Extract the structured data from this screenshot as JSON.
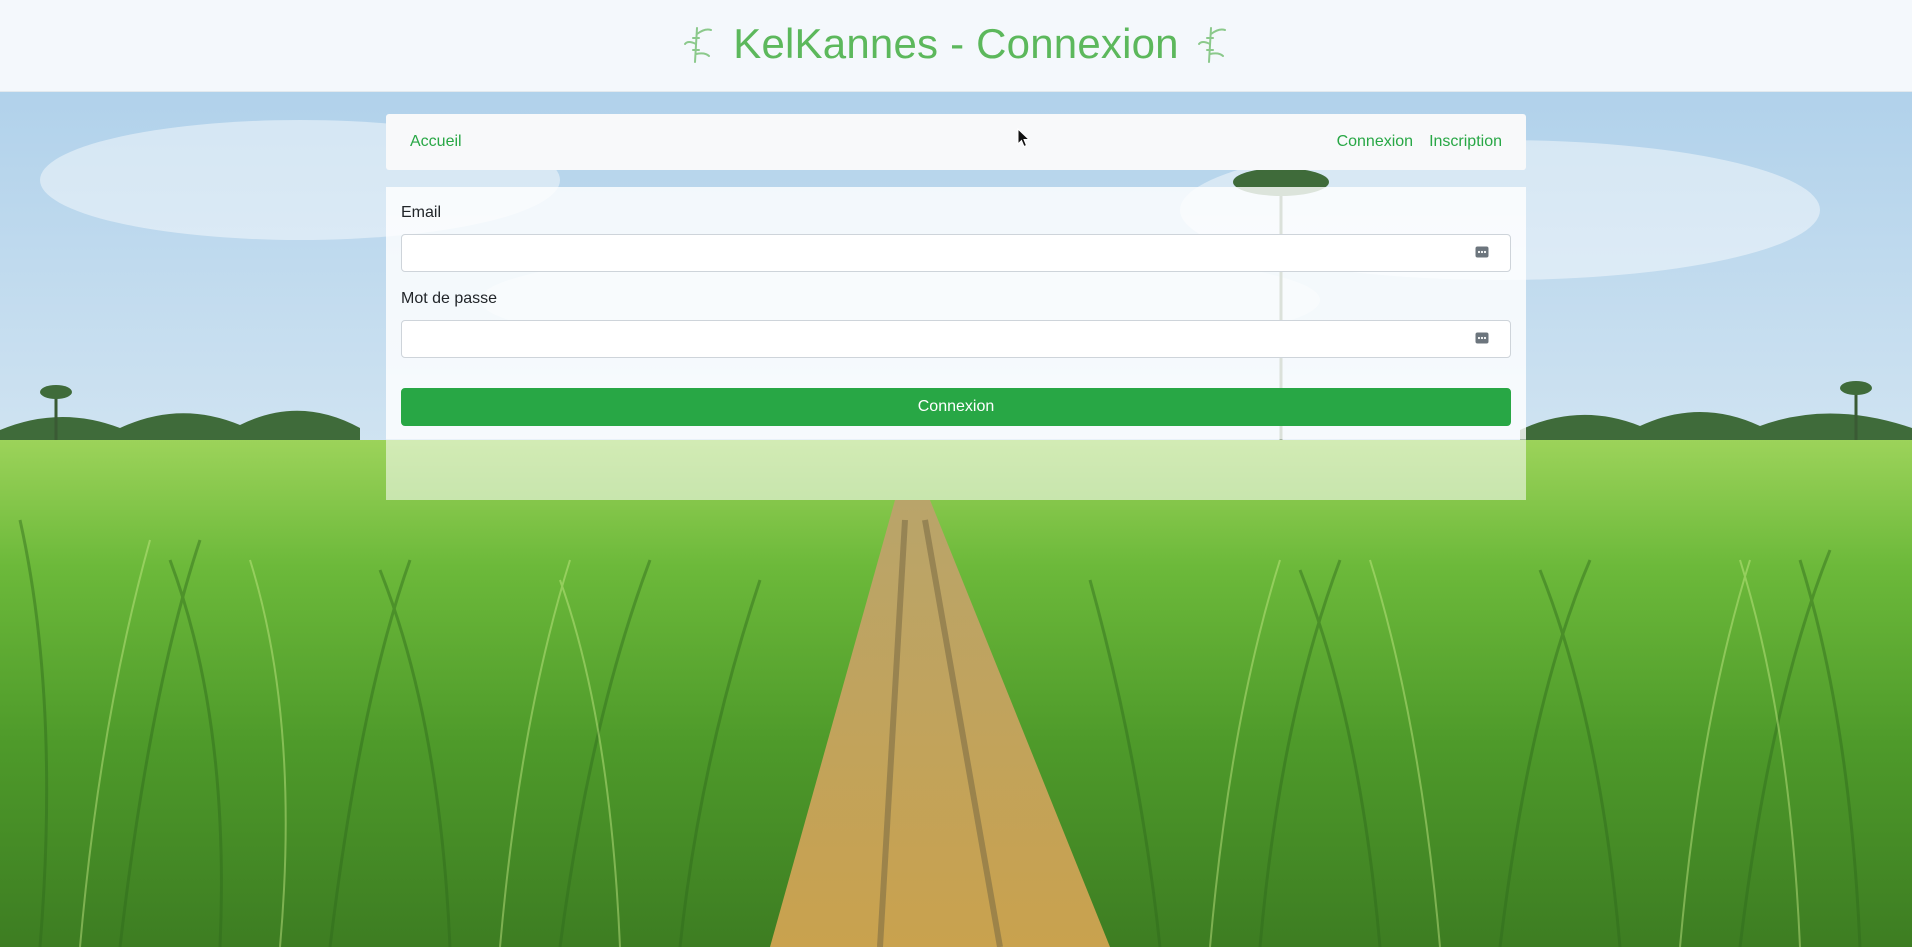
{
  "header": {
    "title": "KelKannes - Connexion",
    "title_color": "#5cb85c"
  },
  "navbar": {
    "home_label": "Accueil",
    "login_label": "Connexion",
    "signup_label": "Inscription",
    "link_color": "#28a745"
  },
  "login_form": {
    "email_label": "Email",
    "email_value": "",
    "password_label": "Mot de passe",
    "password_value": "",
    "submit_label": "Connexion",
    "submit_color": "#28a745"
  },
  "icons": {
    "title_left": "bamboo-icon",
    "title_right": "bamboo-icon",
    "email_field": "password-manager-key-icon",
    "password_field": "password-manager-key-icon"
  },
  "background": {
    "subject": "sugarcane-field-photo",
    "sky_color": "#c4dcef",
    "cane_color": "#6fb83a",
    "path_color": "#c9a85a"
  }
}
